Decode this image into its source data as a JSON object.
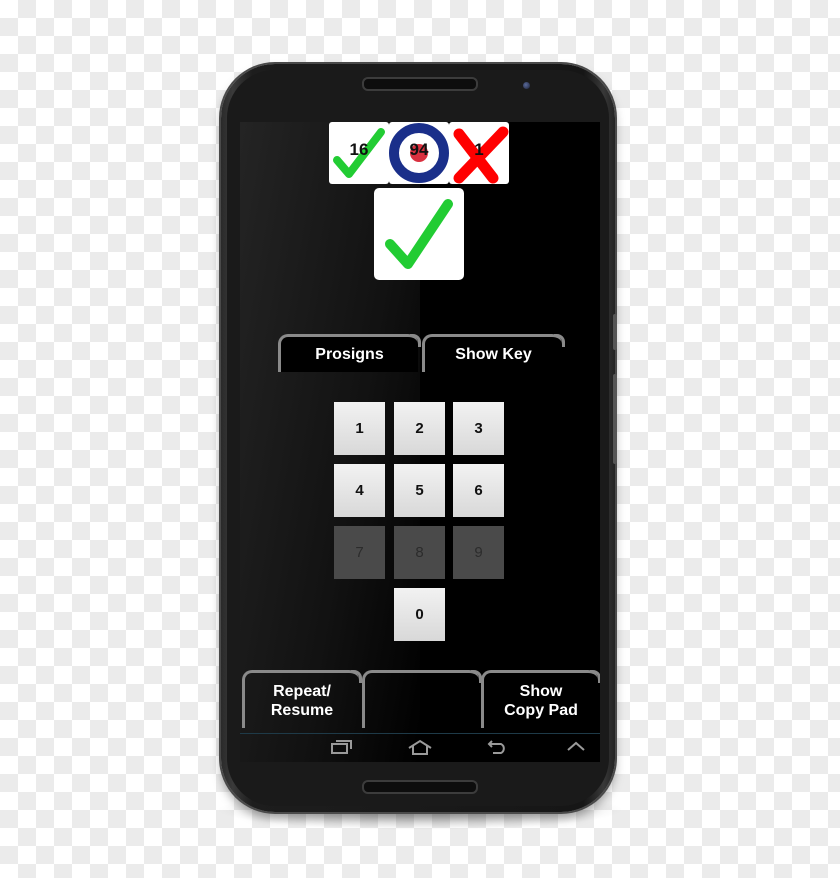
{
  "scoreboard": {
    "correct_count": "16",
    "target_score": "94",
    "wrong_count": "1",
    "correct_icon": "green-checkmark",
    "target_icon": "roundel-target",
    "wrong_icon": "red-x"
  },
  "result": {
    "icon": "green-checkmark"
  },
  "tabs": [
    {
      "label": "Prosigns"
    },
    {
      "label": "Show Key"
    }
  ],
  "keypad": {
    "keys": [
      {
        "label": "1",
        "enabled": true
      },
      {
        "label": "2",
        "enabled": true
      },
      {
        "label": "3",
        "enabled": true
      },
      {
        "label": "4",
        "enabled": true
      },
      {
        "label": "5",
        "enabled": true
      },
      {
        "label": "6",
        "enabled": true
      },
      {
        "label": "7",
        "enabled": false
      },
      {
        "label": "8",
        "enabled": false
      },
      {
        "label": "9",
        "enabled": false
      },
      {
        "label": "0",
        "enabled": true
      }
    ]
  },
  "bottom_buttons": [
    {
      "line1": "Repeat/",
      "line2": "Resume"
    },
    {
      "line1": "",
      "line2": ""
    },
    {
      "line1": "Show",
      "line2": "Copy Pad"
    }
  ],
  "nav_bar": {
    "icons": [
      "recent-apps-icon",
      "home-icon",
      "back-icon",
      "chevron-up-icon"
    ]
  },
  "colors": {
    "check_green": "#22cc33",
    "x_red": "#ff0000",
    "roundel_blue": "#1a2f8a",
    "roundel_red": "#d9303f",
    "key_enabled": "#e6e6e6",
    "key_disabled": "#4a4a4a"
  }
}
